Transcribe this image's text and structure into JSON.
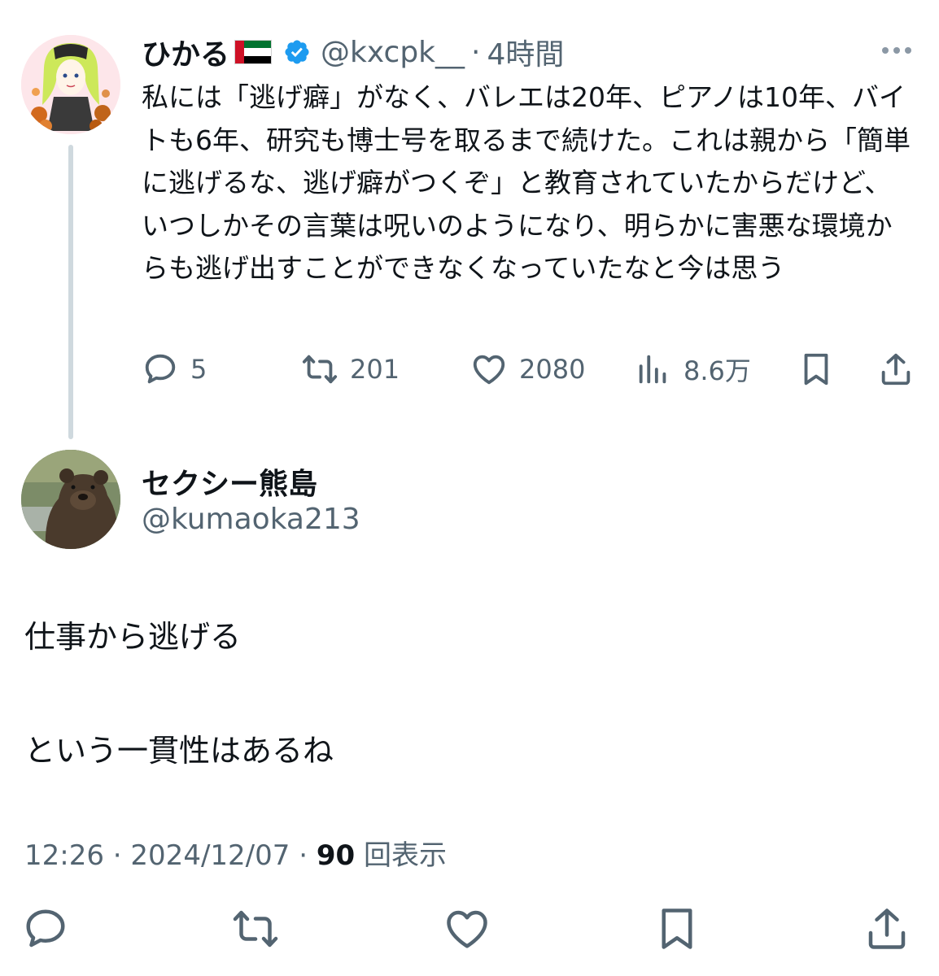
{
  "parent_tweet": {
    "display_name": "ひかる",
    "flag_icon": "uae-flag-icon",
    "verified_icon": "verified-badge-icon",
    "handle": "@kxcpk__",
    "separator": "·",
    "time": "4時間",
    "text": "私には「逃げ癖」がなく、バレエは20年、ピアノは10年、バイトも6年、研究も博士号を取るまで続けた。これは親から「簡単に逃げるな、逃げ癖がつくぞ」と教育されていたからだけど、いつしかその言葉は呪いのようになり、明らかに害悪な環境からも逃げ出すことができなくなっていたなと今は思う",
    "counts": {
      "replies": "5",
      "retweets": "201",
      "likes": "2080",
      "views": "8.6万"
    }
  },
  "reply_tweet": {
    "display_name": "セクシー熊島",
    "handle": "@kumaoka213",
    "line1": "仕事から逃げる",
    "line2": "という一貫性はあるね",
    "time": "12:26",
    "separator": "·",
    "date": "2024/12/07",
    "views_count": "90",
    "views_label": "回表示"
  },
  "colors": {
    "text_primary": "#0f1419",
    "text_secondary": "#536471",
    "verified_blue": "#1d9bf0",
    "thread_line": "#cfd9de"
  }
}
